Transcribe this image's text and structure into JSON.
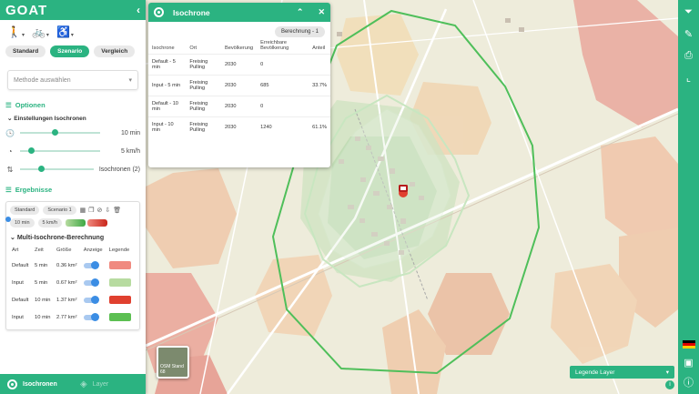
{
  "app": {
    "logo": "GOAT"
  },
  "sidebar": {
    "modes": [
      {
        "name": "walking-icon",
        "state": "active"
      },
      {
        "name": "bicycle-icon",
        "state": "inactive"
      },
      {
        "name": "wheelchair-icon",
        "state": "inactive"
      }
    ],
    "scenario_tabs": [
      "Standard",
      "Szenario",
      "Vergleich"
    ],
    "active_tab": "Szenario",
    "method_placeholder": "Methode auswählen",
    "options_title": "Optionen",
    "settings_title": "Einstellungen Isochronen",
    "sliders": [
      {
        "icon": "clock-icon",
        "value_label": "10 min",
        "level": 0.4
      },
      {
        "icon": "speedometer-icon",
        "value_label": "5 km/h",
        "level": 0.1
      },
      {
        "icon": "sort-icon",
        "value_label": "Isochronen (2)",
        "level": 0.25
      }
    ],
    "results_title": "Ergebnisse",
    "result_card": {
      "chip_standard": "Standard",
      "chip_scenario": "Scenario 1",
      "chip_time": "10 min",
      "chip_speed": "5 km/h",
      "title": "Multi-Isochrone-Berechnung",
      "columns": [
        "Art",
        "Zeit",
        "Größe",
        "Anzeige",
        "Legende"
      ],
      "rows": [
        {
          "art": "Default",
          "zeit": "5 min",
          "groesse": "0.36 km²",
          "color": "#f08a80"
        },
        {
          "art": "Input",
          "zeit": "5 min",
          "groesse": "0.67 km²",
          "color": "#b7dba0"
        },
        {
          "art": "Default",
          "zeit": "10 min",
          "groesse": "1.37 km²",
          "color": "#e0402f"
        },
        {
          "art": "Input",
          "zeit": "10 min",
          "groesse": "2.77 km²",
          "color": "#5cbf52"
        }
      ]
    },
    "footer": {
      "isochronen": "Isochronen",
      "layer": "Layer"
    }
  },
  "popup": {
    "title": "Isochrone",
    "badge": "Berechnung - 1",
    "columns": [
      "Isochrone",
      "Ort",
      "Bevölkerung",
      "Erreichbare Bevölkerung",
      "Anteil"
    ],
    "rows": [
      {
        "iso": "Default - 5 min",
        "ort": "Freising Pulling",
        "bev": "2030",
        "erreich": "0",
        "anteil": ""
      },
      {
        "iso": "Input - 5 min",
        "ort": "Freising Pulling",
        "bev": "2030",
        "erreich": "685",
        "anteil": "33.7%"
      },
      {
        "iso": "Default - 10 min",
        "ort": "Freising Pulling",
        "bev": "2030",
        "erreich": "0",
        "anteil": ""
      },
      {
        "iso": "Input - 10 min",
        "ort": "Freising Pulling",
        "bev": "2030",
        "erreich": "1240",
        "anteil": "61.1%"
      }
    ]
  },
  "map": {
    "thumbnail_label": "OSM Stand 68",
    "legend_layer_label": "Legende Layer"
  },
  "colors": {
    "accent": "#2bb381",
    "isochrone_line": "#4fbf5a"
  }
}
